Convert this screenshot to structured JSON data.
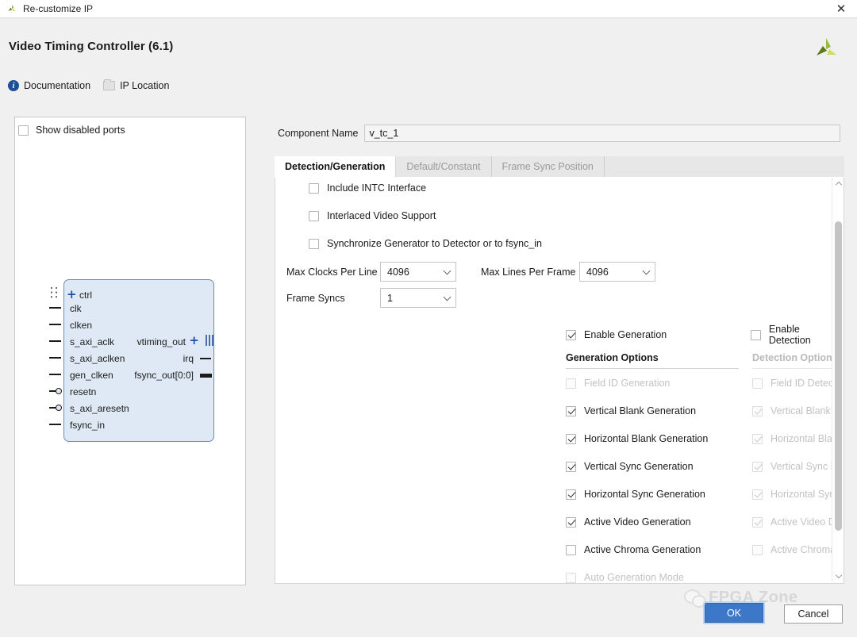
{
  "window": {
    "title": "Re-customize IP",
    "app_icon": "xilinx-logo-icon",
    "close_label": "✕"
  },
  "header": {
    "ip_title": "Video Timing Controller (6.1)",
    "logo": "xilinx-logo-icon",
    "links": [
      {
        "label": "Documentation",
        "icon": "info-icon"
      },
      {
        "label": "IP Location",
        "icon": "folder-icon"
      }
    ]
  },
  "symbol_panel": {
    "show_disabled_ports": {
      "label": "Show disabled ports",
      "checked": false
    },
    "left_ports": [
      {
        "name": "ctrl",
        "type": "bus-expandable"
      },
      {
        "name": "clk",
        "type": "pin"
      },
      {
        "name": "clken",
        "type": "pin"
      },
      {
        "name": "s_axi_aclk",
        "type": "pin"
      },
      {
        "name": "s_axi_aclken",
        "type": "pin"
      },
      {
        "name": "gen_clken",
        "type": "pin"
      },
      {
        "name": "resetn",
        "type": "pin-inverted"
      },
      {
        "name": "s_axi_aresetn",
        "type": "pin-inverted"
      },
      {
        "name": "fsync_in",
        "type": "pin"
      }
    ],
    "right_ports": [
      {
        "name": "vtiming_out",
        "type": "bus-expandable"
      },
      {
        "name": "irq",
        "type": "pin"
      },
      {
        "name": "fsync_out[0:0]",
        "type": "bus"
      }
    ]
  },
  "component": {
    "label": "Component Name",
    "value": "v_tc_1"
  },
  "tabs": [
    {
      "label": "Detection/Generation",
      "active": true
    },
    {
      "label": "Default/Constant",
      "active": false
    },
    {
      "label": "Frame Sync Position",
      "active": false
    }
  ],
  "top_options": [
    {
      "label": "Include INTC Interface",
      "checked": false,
      "enabled": true
    },
    {
      "label": "Interlaced Video Support",
      "checked": false,
      "enabled": true
    },
    {
      "label": "Synchronize Generator to Detector or to fsync_in",
      "checked": false,
      "enabled": true
    }
  ],
  "combos": [
    {
      "label": "Max Clocks Per Line",
      "value": "4096"
    },
    {
      "label": "Max Lines Per Frame",
      "value": "4096"
    },
    {
      "label": "Frame Syncs",
      "value": "1"
    }
  ],
  "enable_generation": {
    "label": "Enable Generation",
    "checked": true,
    "enabled": true
  },
  "enable_detection": {
    "label": "Enable Detection",
    "checked": false,
    "enabled": true
  },
  "generation": {
    "heading": "Generation Options",
    "enabled": true,
    "items": [
      {
        "label": "Field ID Generation",
        "checked": false,
        "enabled": false
      },
      {
        "label": "Vertical Blank Generation",
        "checked": true,
        "enabled": true
      },
      {
        "label": "Horizontal Blank Generation",
        "checked": true,
        "enabled": true
      },
      {
        "label": "Vertical Sync Generation",
        "checked": true,
        "enabled": true
      },
      {
        "label": "Horizontal Sync Generation",
        "checked": true,
        "enabled": true
      },
      {
        "label": "Active Video Generation",
        "checked": true,
        "enabled": true
      },
      {
        "label": "Active Chroma Generation",
        "checked": false,
        "enabled": true
      },
      {
        "label": "Auto Generation Mode",
        "checked": false,
        "enabled": false
      }
    ]
  },
  "detection": {
    "heading": "Detection Options",
    "enabled": false,
    "items": [
      {
        "label": "Field ID Detection",
        "checked": false,
        "enabled": false
      },
      {
        "label": "Vertical Blank Detection",
        "checked": true,
        "enabled": false
      },
      {
        "label": "Horizontal Blank Detection",
        "checked": true,
        "enabled": false
      },
      {
        "label": "Vertical Sync Detection",
        "checked": true,
        "enabled": false
      },
      {
        "label": "Horizontal Sync Detection",
        "checked": true,
        "enabled": false
      },
      {
        "label": "Active Video Detection",
        "checked": true,
        "enabled": false
      },
      {
        "label": "Active Chroma Detection",
        "checked": false,
        "enabled": false
      }
    ]
  },
  "footer": {
    "ok_label": "OK",
    "cancel_label": "Cancel"
  },
  "watermark": {
    "text": "FPGA Zone",
    "icon": "wechat-icon"
  },
  "colors": {
    "accent_blue": "#3d78c8",
    "symbol_fill": "#dfe9f5",
    "symbol_border": "#6d8cb0",
    "bus_blue": "#1f4fa8",
    "logo_green": "#9aba3a"
  }
}
